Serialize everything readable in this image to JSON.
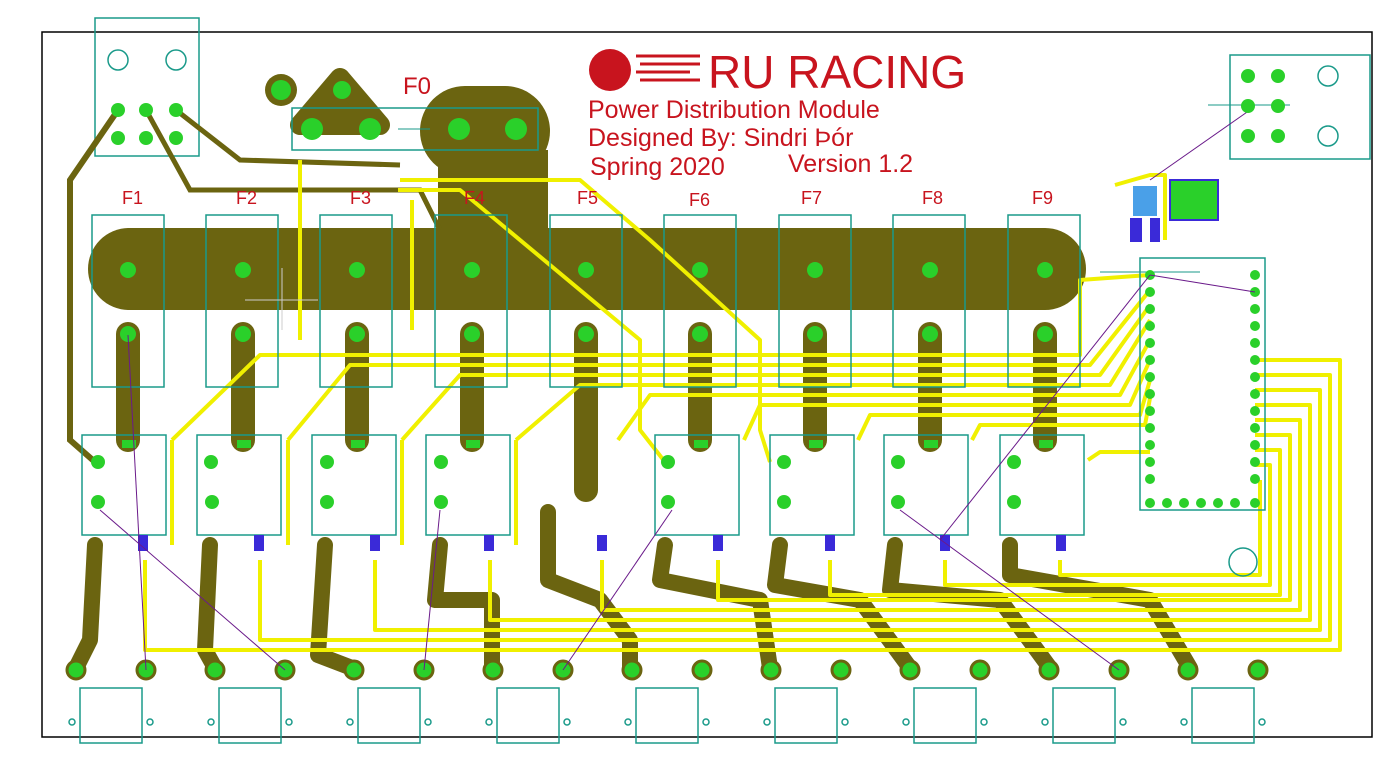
{
  "logo": {
    "text": "RU RACING",
    "brand_color": "#c8141e"
  },
  "title_block": {
    "line1": "Power Distribution Module",
    "line2": "Designed By:  Sindri Þór",
    "line3": "Spring 2020",
    "version": "Version 1.2"
  },
  "fuses": {
    "main": "F0",
    "labels": [
      "F1",
      "F2",
      "F3",
      "F4",
      "F5",
      "F6",
      "F7",
      "F8",
      "F9"
    ]
  },
  "colors": {
    "copper": "#6b6410",
    "trace": "#f0f000",
    "pad": "#2ad02a",
    "outline": "#1a9a8a",
    "silk": "#c8141e",
    "ratsnest": "#6a1a8a",
    "smd": "#3a2ad8"
  }
}
